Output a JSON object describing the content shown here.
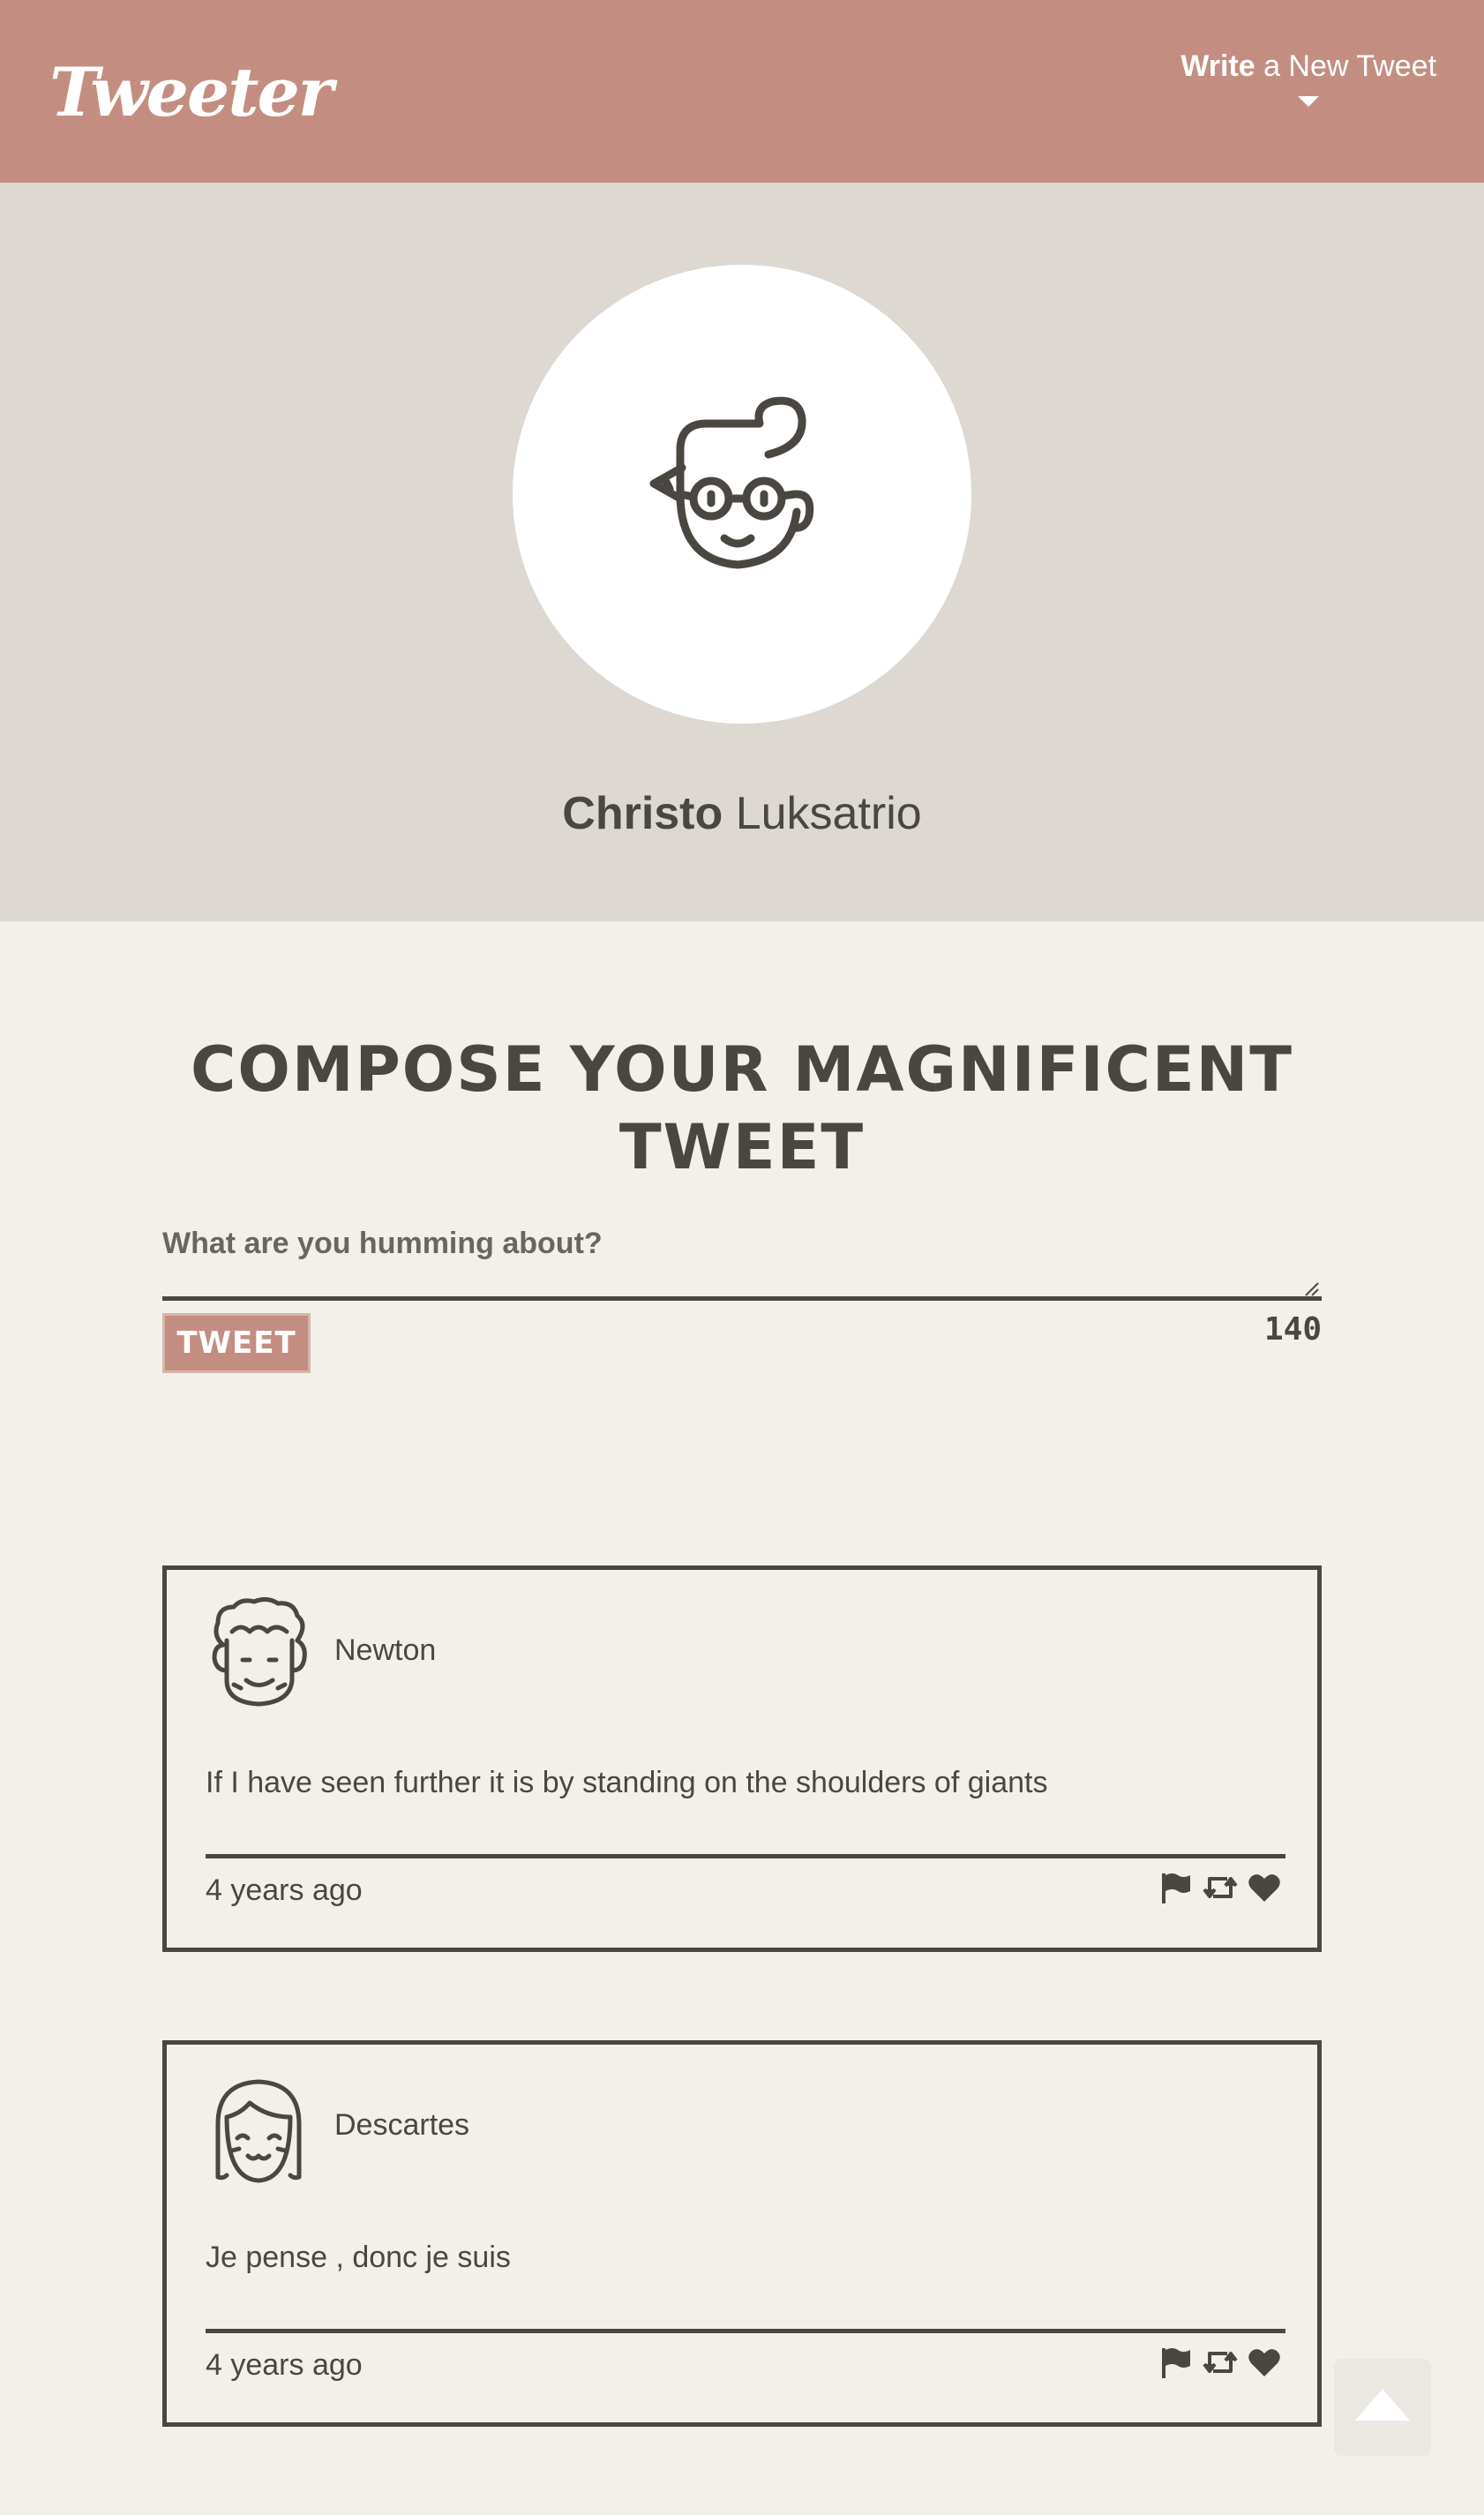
{
  "nav": {
    "logo": "Tweeter",
    "write_bold": "Write",
    "write_rest": " a New Tweet"
  },
  "profile": {
    "first_name": "Christo",
    "last_name": " Luksatrio",
    "avatar_icon": "person-with-glasses-icon"
  },
  "compose": {
    "title": "Compose your magnificent tweet",
    "placeholder": "What are you humming about?",
    "button_label": "Tweet",
    "counter": "140"
  },
  "tweets": [
    {
      "author": "Newton",
      "text": "If I have seen further it is by standing on the shoulders of giants",
      "time": "4 years ago",
      "avatar_icon": "curly-hair-face-icon"
    },
    {
      "author": "Descartes",
      "text": "Je pense , donc je suis",
      "time": "4 years ago",
      "avatar_icon": "bob-hair-face-icon"
    }
  ],
  "actions": [
    "flag-icon",
    "retweet-icon",
    "heart-icon"
  ],
  "colors": {
    "nav_bg": "#c38e81",
    "header_bg": "#ddd8d2",
    "page_bg": "#f2f0eb",
    "text": "#4a4641"
  }
}
